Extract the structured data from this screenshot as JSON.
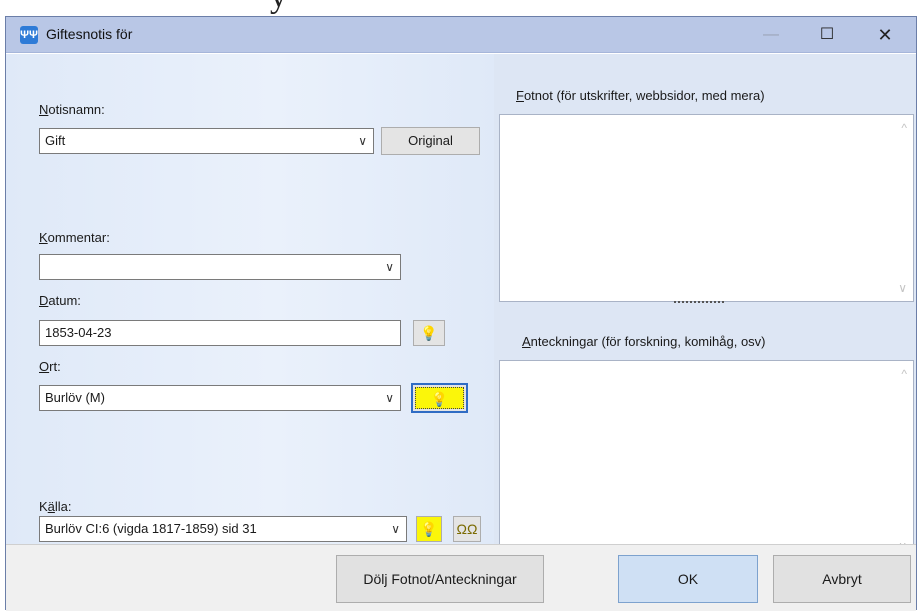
{
  "window": {
    "title": "Giftesnotis för",
    "minimize_glyph": "—",
    "maximize_glyph": "☐",
    "close_glyph": "✕",
    "app_icon": "family-tree-icon"
  },
  "form": {
    "notisnamn": {
      "label_accesskey": "N",
      "label_rest": "otisnamn:",
      "value": "Gift",
      "original_button": "Original"
    },
    "kommentar": {
      "label_accesskey": "K",
      "label_rest": "ommentar:",
      "value": ""
    },
    "datum": {
      "label_accesskey": "D",
      "label_rest": "atum:",
      "value": "1853-04-23"
    },
    "ort": {
      "label_accesskey": "O",
      "label_rest": "rt:",
      "value": "Burlöv (M)"
    },
    "kalla": {
      "label_pre": "K",
      "label_accesskey": "ä",
      "label_rest": "lla:",
      "value": "Burlöv CI:6 (vigda 1817-1859) sid 31"
    }
  },
  "notes": {
    "fotnot": {
      "label_accesskey": "F",
      "label_rest": "otnot (för utskrifter, webbsidor, med mera)",
      "value": ""
    },
    "anteckningar": {
      "label_accesskey": "A",
      "label_rest": "nteckningar (för forskning, komihåg, osv)",
      "value": ""
    }
  },
  "buttons": {
    "hide_notes": "Dölj Fotnot/Anteckningar",
    "ok": "OK",
    "cancel": "Avbryt"
  },
  "icons": {
    "bulb": "💡",
    "chevron": "∨",
    "scroll_up": "^",
    "scroll_down": "∨"
  },
  "colors": {
    "accent_yellow": "#fbf60a",
    "titlebar": "#b9c7e6",
    "ok_button": "#cfe0f4"
  }
}
